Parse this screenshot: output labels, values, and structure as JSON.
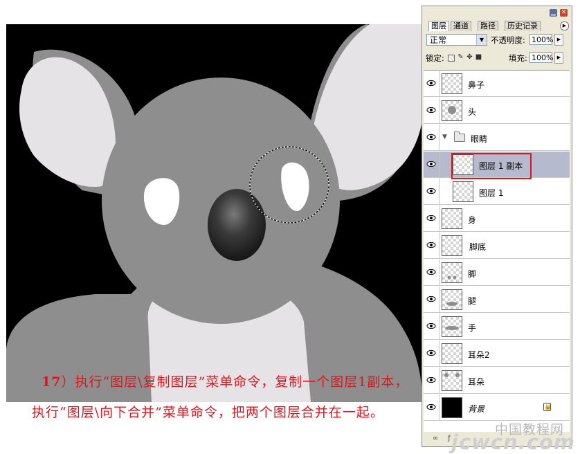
{
  "caption": {
    "line1_num": "17",
    "line1": "）执行“图层\\复制图层”菜单命令，复制一个图层1副本，",
    "line2": "执行“图层\\向下合并”菜单命令，把两个图层合并在一起。"
  },
  "watermark": {
    "top": "中国教程网",
    "bottom": "jcwcn.com"
  },
  "palette": {
    "tabs": [
      "图层",
      "通道",
      "路径",
      "历史记录"
    ],
    "active_tab": "图层",
    "blend_mode": "正常",
    "opacity_label": "不透明度:",
    "opacity_value": "100%",
    "lock_label": "锁定:",
    "fill_label": "填充:",
    "fill_value": "100%",
    "layers": [
      {
        "name": "鼻子",
        "visible": true
      },
      {
        "name": "头",
        "visible": true
      },
      {
        "name": "眼睛",
        "visible": true,
        "type": "group",
        "expanded": true
      },
      {
        "name": "图层 1 副本",
        "visible": false,
        "selected": true,
        "indent": true
      },
      {
        "name": "图层 1",
        "visible": true,
        "indent": true
      },
      {
        "name": "身",
        "visible": true
      },
      {
        "name": "脚底",
        "visible": true
      },
      {
        "name": "脚",
        "visible": true
      },
      {
        "name": "腿",
        "visible": true
      },
      {
        "name": "手",
        "visible": true
      },
      {
        "name": "耳朵2",
        "visible": true
      },
      {
        "name": "耳朵",
        "visible": true
      },
      {
        "name": "背景",
        "visible": true,
        "locked": true,
        "background": true
      }
    ]
  },
  "colors": {
    "caption": "#e0141c",
    "highlight": "#e0141c",
    "selected_row": "#b6bacf",
    "koala_body": "#8e8e8e",
    "koala_light": "#e5e3e6",
    "canvas_bg": "#000000"
  }
}
